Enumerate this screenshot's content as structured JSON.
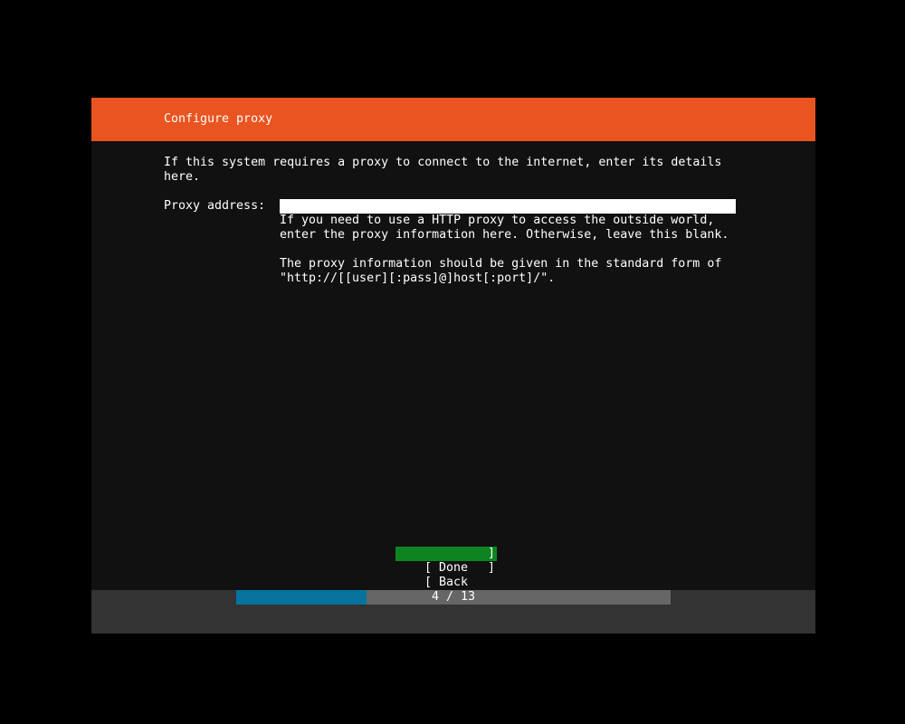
{
  "colors": {
    "background": "#000000",
    "panel": "#111111",
    "header": "#e95420",
    "button_focus": "#0e8420",
    "footer": "#333333",
    "progress_track": "#666666",
    "progress_fill": "#06739e"
  },
  "header": {
    "title": "Configure proxy"
  },
  "intro": {
    "lines": [
      "If this system requires a proxy to connect to the internet, enter its details",
      "here."
    ]
  },
  "proxy": {
    "label": "Proxy address:",
    "value": "",
    "help_lines": [
      "If you need to use a HTTP proxy to access the outside world,",
      "enter the proxy information here. Otherwise, leave this blank.",
      "",
      "The proxy information should be given in the standard form of",
      "\"http://[[user][:pass]@]host[:port]/\"."
    ]
  },
  "buttons": {
    "done": {
      "left": "[ Done",
      "right": "]"
    },
    "back": {
      "left": "[ Back",
      "right": "]"
    }
  },
  "progress": {
    "current": 4,
    "total": 13,
    "fraction": 0.3,
    "label": "4 / 13"
  }
}
